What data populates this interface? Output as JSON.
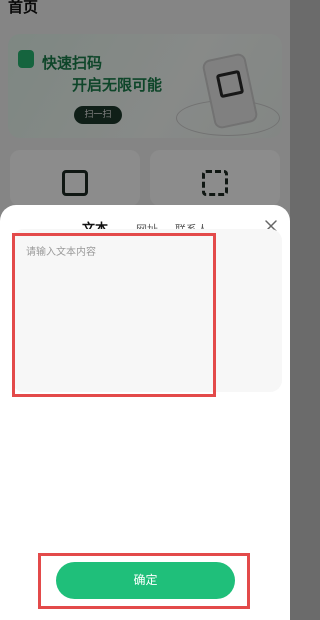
{
  "background": {
    "page_title": "首页",
    "banner_line1": "快速扫码",
    "banner_line2": "开启无限可能",
    "banner_button": "扫一扫"
  },
  "sheet": {
    "tabs": [
      {
        "label": "文本",
        "active": true
      },
      {
        "label": "网址",
        "active": false
      },
      {
        "label": "联系人",
        "active": false
      }
    ],
    "text_input": {
      "placeholder": "请输入文本内容",
      "value": ""
    },
    "confirm_label": "确定",
    "close_icon": "close-icon"
  },
  "colors": {
    "accent": "#1fbf7a",
    "highlight": "#e34a4a"
  }
}
